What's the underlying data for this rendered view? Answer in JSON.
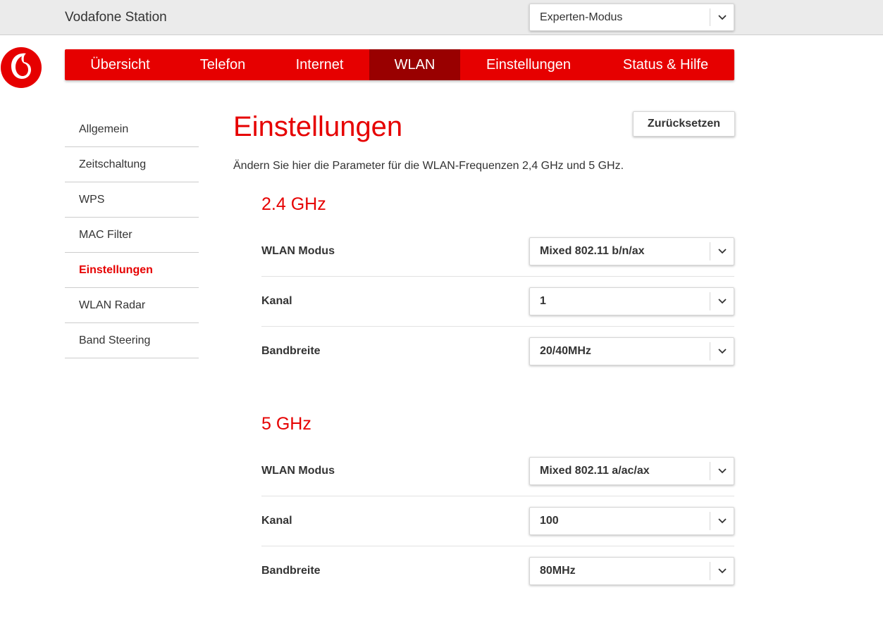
{
  "header": {
    "title": "Vodafone Station",
    "mode_select": {
      "value": "Experten-Modus",
      "icon": "chevron-down-icon"
    }
  },
  "brand": {
    "logo": "vodafone-logo",
    "color": "#e60000",
    "active_color": "#990000"
  },
  "nav": {
    "items": [
      {
        "label": "Übersicht"
      },
      {
        "label": "Telefon"
      },
      {
        "label": "Internet"
      },
      {
        "label": "WLAN",
        "active": true
      },
      {
        "label": "Einstellungen"
      },
      {
        "label": "Status & Hilfe"
      }
    ]
  },
  "sidebar": {
    "items": [
      {
        "label": "Allgemein"
      },
      {
        "label": "Zeitschaltung"
      },
      {
        "label": "WPS"
      },
      {
        "label": "MAC Filter"
      },
      {
        "label": "Einstellungen",
        "active": true
      },
      {
        "label": "WLAN Radar"
      },
      {
        "label": "Band Steering"
      }
    ]
  },
  "main": {
    "title": "Einstellungen",
    "reset_label": "Zurücksetzen",
    "description": "Ändern Sie hier die Parameter für die WLAN-Frequenzen 2,4 GHz und 5 GHz.",
    "sections": [
      {
        "title": "2.4 GHz",
        "rows": [
          {
            "label": "WLAN Modus",
            "value": "Mixed 802.11 b/n/ax"
          },
          {
            "label": "Kanal",
            "value": "1"
          },
          {
            "label": "Bandbreite",
            "value": "20/40MHz"
          }
        ]
      },
      {
        "title": "5 GHz",
        "rows": [
          {
            "label": "WLAN Modus",
            "value": "Mixed 802.11 a/ac/ax"
          },
          {
            "label": "Kanal",
            "value": "100"
          },
          {
            "label": "Bandbreite",
            "value": "80MHz"
          }
        ]
      }
    ]
  }
}
